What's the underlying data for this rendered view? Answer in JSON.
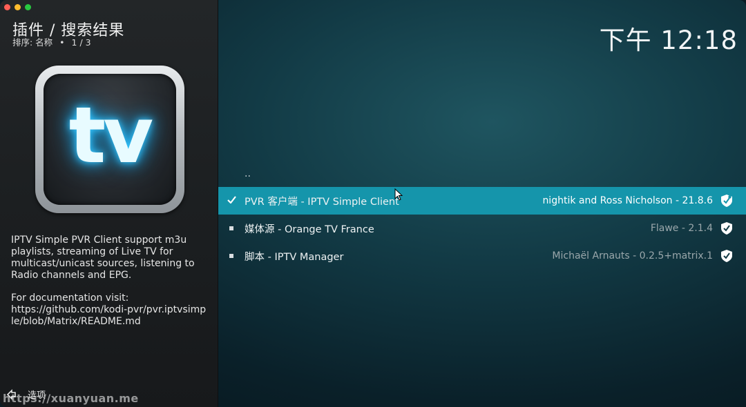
{
  "header": {
    "title": "插件 / 搜索结果",
    "sort_label": "排序: 名称",
    "bullet": "•",
    "page_count": "1 / 3",
    "clock": "下午 12:18"
  },
  "addon_icon": {
    "text": "tv",
    "glow_color": "#37c8ff"
  },
  "description": {
    "summary": "IPTV Simple PVR Client support m3u playlists, streaming of Live TV for multicast/unicast sources, listening to Radio channels and EPG.",
    "doc_intro": "For documentation visit:",
    "doc_url": "https://github.com/kodi-pvr/pvr.iptvsimple/blob/Matrix/README.md"
  },
  "list": {
    "parent_label": "..",
    "items": [
      {
        "name": "PVR 客户端 - IPTV Simple Client",
        "author": "nightik and Ross Nicholson - 21.8.6",
        "status": "installed-selected",
        "icon": "update-shield-icon"
      },
      {
        "name": "媒体源 - Orange TV France",
        "author": "Flawe - 2.1.4",
        "status": "bullet",
        "icon": "check-shield-icon"
      },
      {
        "name": "脚本 - IPTV Manager",
        "author": "Michaël Arnauts - 0.2.5+matrix.1",
        "status": "bullet",
        "icon": "check-shield-icon"
      }
    ]
  },
  "footer": {
    "options_label": "选项",
    "options_icon": "options-arrows-icon"
  },
  "watermark": "https://xuanyuan.me",
  "colors": {
    "selection": "#1595ab",
    "background": "#123a45",
    "panel": "#1c1f21"
  }
}
